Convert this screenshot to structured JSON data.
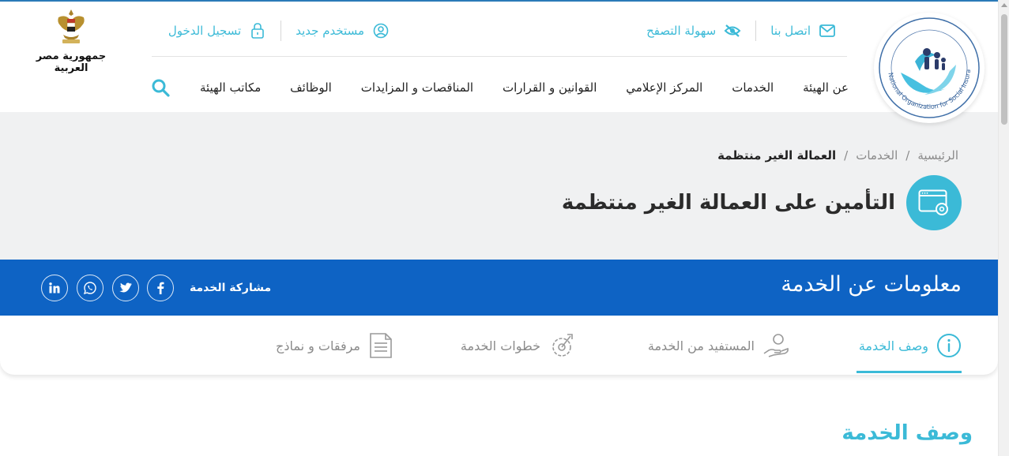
{
  "header": {
    "country_label": "جمهورية مصر العربية",
    "top_links": {
      "contact": "اتصل بنا",
      "accessibility": "سهولة التصفح",
      "new_user": "مستخدم جديد",
      "login": "تسجيل الدخول"
    },
    "nav": [
      {
        "label": "عن الهيئة"
      },
      {
        "label": "الخدمات"
      },
      {
        "label": "المركز الإعلامي"
      },
      {
        "label": "القوانين و القرارات"
      },
      {
        "label": "المناقصات و المزايدات"
      },
      {
        "label": "الوظائف"
      },
      {
        "label": "مكاتب الهيئة"
      }
    ],
    "logo_text": "National Organization for Social Insurance"
  },
  "breadcrumb": {
    "home": "الرئيسية",
    "sep": "/",
    "services": "الخدمات",
    "current": "العمالة الغير منتظمة"
  },
  "page_title": "التأمين على العمالة الغير منتظمة",
  "service_info": {
    "title": "معلومات عن الخدمة",
    "share_label": "مشاركة الخدمة",
    "social_icons": [
      "facebook-icon",
      "twitter-icon",
      "whatsapp-icon",
      "linkedin-icon"
    ]
  },
  "tabs": [
    {
      "label": "وصف الخدمة",
      "icon": "info-icon",
      "active": true
    },
    {
      "label": "المستفيد من الخدمة",
      "icon": "beneficiary-icon",
      "active": false
    },
    {
      "label": "خطوات الخدمة",
      "icon": "steps-icon",
      "active": false
    },
    {
      "label": "مرفقات و نماذج",
      "icon": "document-icon",
      "active": false
    }
  ],
  "section_heading": "وصف الخدمة",
  "colors": {
    "accent": "#3bbad7",
    "primary_blue": "#0e63c4",
    "hero_bg": "#f0f1f2"
  }
}
